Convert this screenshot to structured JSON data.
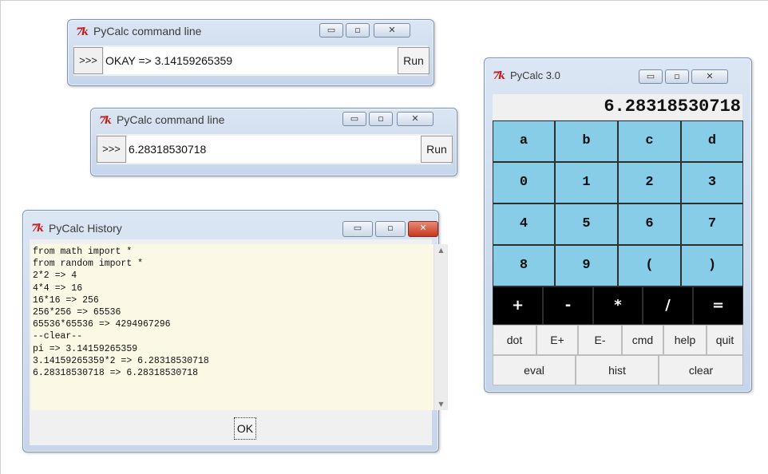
{
  "cmd_window_1": {
    "title": "PyCalc command line",
    "prompt_label": ">>>",
    "input_value": "OKAY => 3.14159265359",
    "run_label": "Run",
    "controls": {
      "minimize": "▭",
      "maximize": "▫",
      "close": "✕"
    }
  },
  "cmd_window_2": {
    "title": "PyCalc command line",
    "prompt_label": ">>>",
    "input_value": "6.28318530718",
    "run_label": "Run",
    "controls": {
      "minimize": "▭",
      "maximize": "▫",
      "close": "✕"
    }
  },
  "history_window": {
    "title": "PyCalc History",
    "lines": [
      "from math import *",
      "from random import *",
      "2*2 => 4",
      "4*4 => 16",
      "16*16 => 256",
      "256*256 => 65536",
      "65536*65536 => 4294967296",
      "--clear--",
      "pi => 3.14159265359",
      "3.14159265359*2 => 6.28318530718",
      "6.28318530718 => 6.28318530718"
    ],
    "ok_label": "OK",
    "controls": {
      "minimize": "▭",
      "maximize": "▫",
      "close": "✕"
    }
  },
  "calc_window": {
    "title": "PyCalc 3.0",
    "display_value": "6.28318530718",
    "key_rows": [
      [
        "a",
        "b",
        "c",
        "d"
      ],
      [
        "0",
        "1",
        "2",
        "3"
      ],
      [
        "4",
        "5",
        "6",
        "7"
      ],
      [
        "8",
        "9",
        "(",
        ")"
      ]
    ],
    "op_keys": [
      "+",
      "-",
      "*",
      "/",
      "="
    ],
    "func_keys_row1": [
      "dot",
      "E+",
      "E-",
      "cmd",
      "help",
      "quit"
    ],
    "func_keys_row2": [
      "eval",
      "hist",
      "clear"
    ],
    "controls": {
      "minimize": "▭",
      "maximize": "▫",
      "close": "✕"
    }
  },
  "colors": {
    "digit_key_bg": "#87cde8",
    "op_key_bg": "#000000",
    "history_bg": "#fbf8e6",
    "title_icon": "#c41a1a"
  }
}
